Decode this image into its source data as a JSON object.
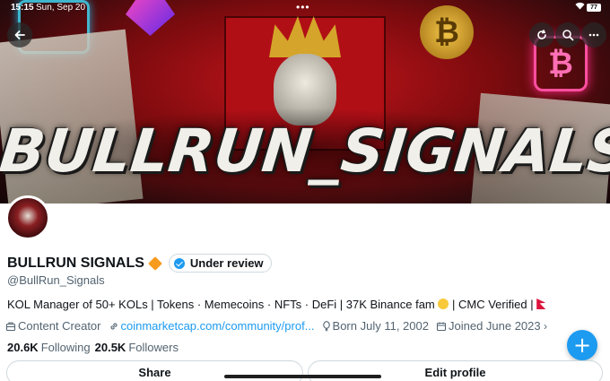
{
  "status_bar": {
    "time": "15:15",
    "date": "Sun, Sep 20",
    "dots": "•••",
    "battery": "77"
  },
  "banner": {
    "title": "BULLRUN_SIGNALS",
    "coin_symbol": "₿",
    "neon_symbol": "₿"
  },
  "profile": {
    "display_name": "BULLRUN SIGNALS",
    "verification_badge": "Under review",
    "handle": "@BullRun_Signals",
    "bio": "KOL Manager of 50+ KOLs | Tokens · Memecoins · NFTs · DeFi | 37K Binance fam",
    "bio_tail": "| CMC Verified |",
    "category": "Content Creator",
    "website": "coinmarketcap.com/community/prof...",
    "birthday": "Born July 11, 2002",
    "joined": "Joined June 2023"
  },
  "stats": {
    "following_count": "20.6K",
    "following_label": "Following",
    "followers_count": "20.5K",
    "followers_label": "Followers"
  },
  "actions": {
    "share_label": "Share",
    "edit_profile_label": "Edit profile",
    "fab_label": "+"
  },
  "icons": {
    "back": "arrow-left-icon",
    "refresh": "refresh-icon",
    "search": "search-icon",
    "more": "more-horizontal-icon",
    "verified": "verified-check-icon",
    "category": "briefcase-icon",
    "website": "link-icon",
    "birthday": "balloon-icon",
    "joined": "calendar-icon"
  },
  "colors": {
    "accent": "#1d9bf0",
    "text_primary": "#0f1419",
    "text_secondary": "#536471",
    "banner_red": "#b10f16"
  }
}
